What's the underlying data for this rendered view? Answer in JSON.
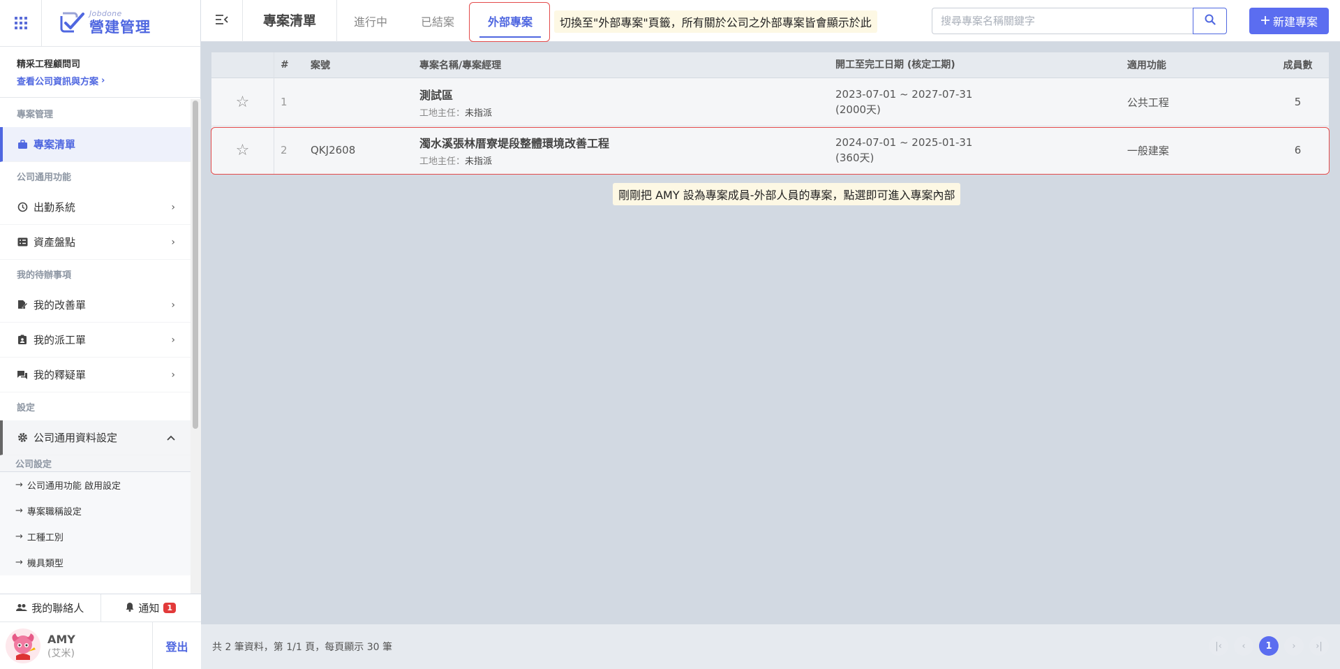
{
  "brand": {
    "sub": "Jobdone",
    "main": "營建管理"
  },
  "company": {
    "name": "精采工程顧問司",
    "link": "查看公司資訊與方案"
  },
  "sidebar": {
    "sections": {
      "project_mgmt": "專案管理",
      "common": "公司通用功能",
      "todo": "我的待辦事項",
      "settings": "設定"
    },
    "items": {
      "project_list": "專案清單",
      "attendance": "出勤系統",
      "assets": "資產盤點",
      "improve": "我的改善單",
      "dispatch": "我的派工單",
      "clarify": "我的釋疑單",
      "company_settings": "公司通用資料設定"
    },
    "subhead": "公司設定",
    "subitems": [
      "公司通用功能 啟用設定",
      "專案職稱設定",
      "工種工別",
      "機具類型"
    ]
  },
  "bottom": {
    "contacts": "我的聯絡人",
    "notify": "通知",
    "notify_count": "1",
    "user_name": "AMY",
    "user_sub": "(艾米)",
    "logout": "登出"
  },
  "header": {
    "title": "專案清單",
    "tabs": [
      "進行中",
      "已結案",
      "外部專案"
    ],
    "active_tab": "外部專案",
    "search_placeholder": "搜尋專案名稱關鍵字",
    "new_button": "新建專案"
  },
  "tips": {
    "tab_tip": "切換至\"外部專案\"頁籤，所有關於公司之外部專案皆會顯示於此",
    "row_tip": "剛剛把 AMY 設為專案成員-外部人員的專案，點選即可進入專案內部"
  },
  "table": {
    "headers": [
      "#",
      "案號",
      "專案名稱/專案經理",
      "開工至完工日期 (核定工期)",
      "適用功能",
      "成員數"
    ],
    "pm_label": "工地主任：",
    "rows": [
      {
        "no": "1",
        "code": "",
        "name": "測試區",
        "pm": "未指派",
        "date": "2023-07-01 ~ 2027-07-31",
        "duration": "(2000天)",
        "func": "公共工程",
        "members": "5"
      },
      {
        "no": "2",
        "code": "QKJ2608",
        "name": "濁水溪張林厝寮堤段整體環境改善工程",
        "pm": "未指派",
        "date": "2024-07-01 ~ 2025-01-31",
        "duration": "(360天)",
        "func": "一般建案",
        "members": "6"
      }
    ]
  },
  "footer": {
    "summary": "共 2 筆資料，第 1/1 頁，每頁顯示 30 筆",
    "current_page": "1"
  },
  "colors": {
    "accent": "#4f67e0",
    "highlight": "#e34a4a",
    "badge": "#e23a3a"
  }
}
